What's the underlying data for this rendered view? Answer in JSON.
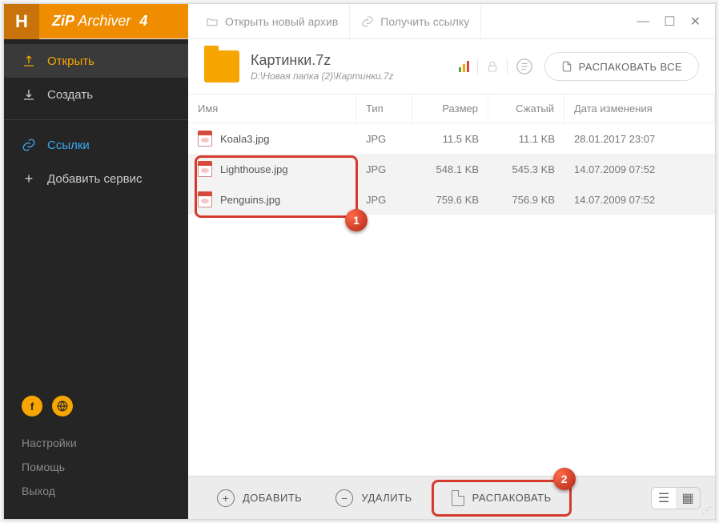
{
  "app": {
    "logo_h": "H",
    "logo_brand": "ZiP",
    "logo_thin": "Archiver",
    "logo_ver": "4"
  },
  "titlebar": {
    "open_archive": "Открыть новый архив",
    "get_link": "Получить ссылку"
  },
  "sidebar": {
    "open": "Открыть",
    "create": "Создать",
    "links": "Ссылки",
    "add_service": "Добавить сервис",
    "settings": "Настройки",
    "help": "Помощь",
    "exit": "Выход"
  },
  "archive": {
    "title": "Картинки.7z",
    "path": "D:\\Новая папка (2)\\Картинки.7z",
    "unpack_all": "РАСПАКОВАТЬ ВСЕ"
  },
  "columns": {
    "name": "Имя",
    "type": "Тип",
    "size": "Размер",
    "packed": "Сжатый",
    "date": "Дата изменения"
  },
  "files": [
    {
      "name": "Koala3.jpg",
      "type": "JPG",
      "size": "11.5 KB",
      "packed": "11.1 KB",
      "date": "28.01.2017 23:07",
      "selected": false
    },
    {
      "name": "Lighthouse.jpg",
      "type": "JPG",
      "size": "548.1 KB",
      "packed": "545.3 KB",
      "date": "14.07.2009 07:52",
      "selected": true
    },
    {
      "name": "Penguins.jpg",
      "type": "JPG",
      "size": "759.6 KB",
      "packed": "756.9 KB",
      "date": "14.07.2009 07:52",
      "selected": true
    }
  ],
  "bottombar": {
    "add": "ДОБАВИТЬ",
    "delete": "УДАЛИТЬ",
    "unpack": "РАСПАКОВАТЬ"
  },
  "callouts": {
    "c1": "1",
    "c2": "2"
  }
}
